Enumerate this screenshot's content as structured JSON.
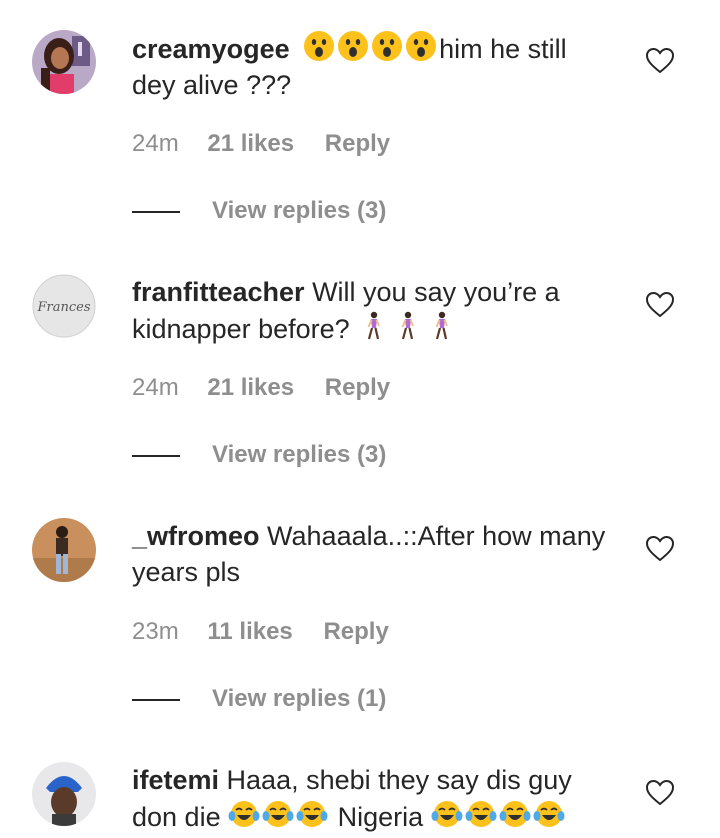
{
  "comments": [
    {
      "username": "creamyogee",
      "text_before": "",
      "emojis_mid": [
        "astonished-face-emoji",
        "astonished-face-emoji",
        "astonished-face-emoji",
        "astonished-face-emoji"
      ],
      "text_after": "him he still dey alive ???",
      "time": "24m",
      "likes": "21 likes",
      "reply_label": "Reply",
      "view_replies": "View replies (3)"
    },
    {
      "username": "franfitteacher",
      "text_before": "Will you say you’re a kidnapper before?",
      "emojis_end": [
        "woman-walking-emoji",
        "woman-walking-emoji",
        "woman-walking-emoji"
      ],
      "avatar_text": "Frances",
      "time": "24m",
      "likes": "21 likes",
      "reply_label": "Reply",
      "view_replies": "View replies (3)"
    },
    {
      "username": "_wfromeo",
      "text_before": "Wahaaala..::After how many years pls",
      "time": "23m",
      "likes": "11 likes",
      "reply_label": "Reply",
      "view_replies": "View replies (1)"
    },
    {
      "username": "ifetemi",
      "text_before": "Haaa, shebi they say dis guy don die",
      "emojis_a": [
        "tears-of-joy-emoji",
        "tears-of-joy-emoji",
        "tears-of-joy-emoji"
      ],
      "text_mid": "Nigeria",
      "emojis_b": [
        "tears-of-joy-emoji",
        "tears-of-joy-emoji",
        "tears-of-joy-emoji",
        "tears-of-joy-emoji"
      ]
    }
  ],
  "colors": {
    "text": "#262626",
    "secondary": "#8e8e8e",
    "background": "#ffffff"
  }
}
